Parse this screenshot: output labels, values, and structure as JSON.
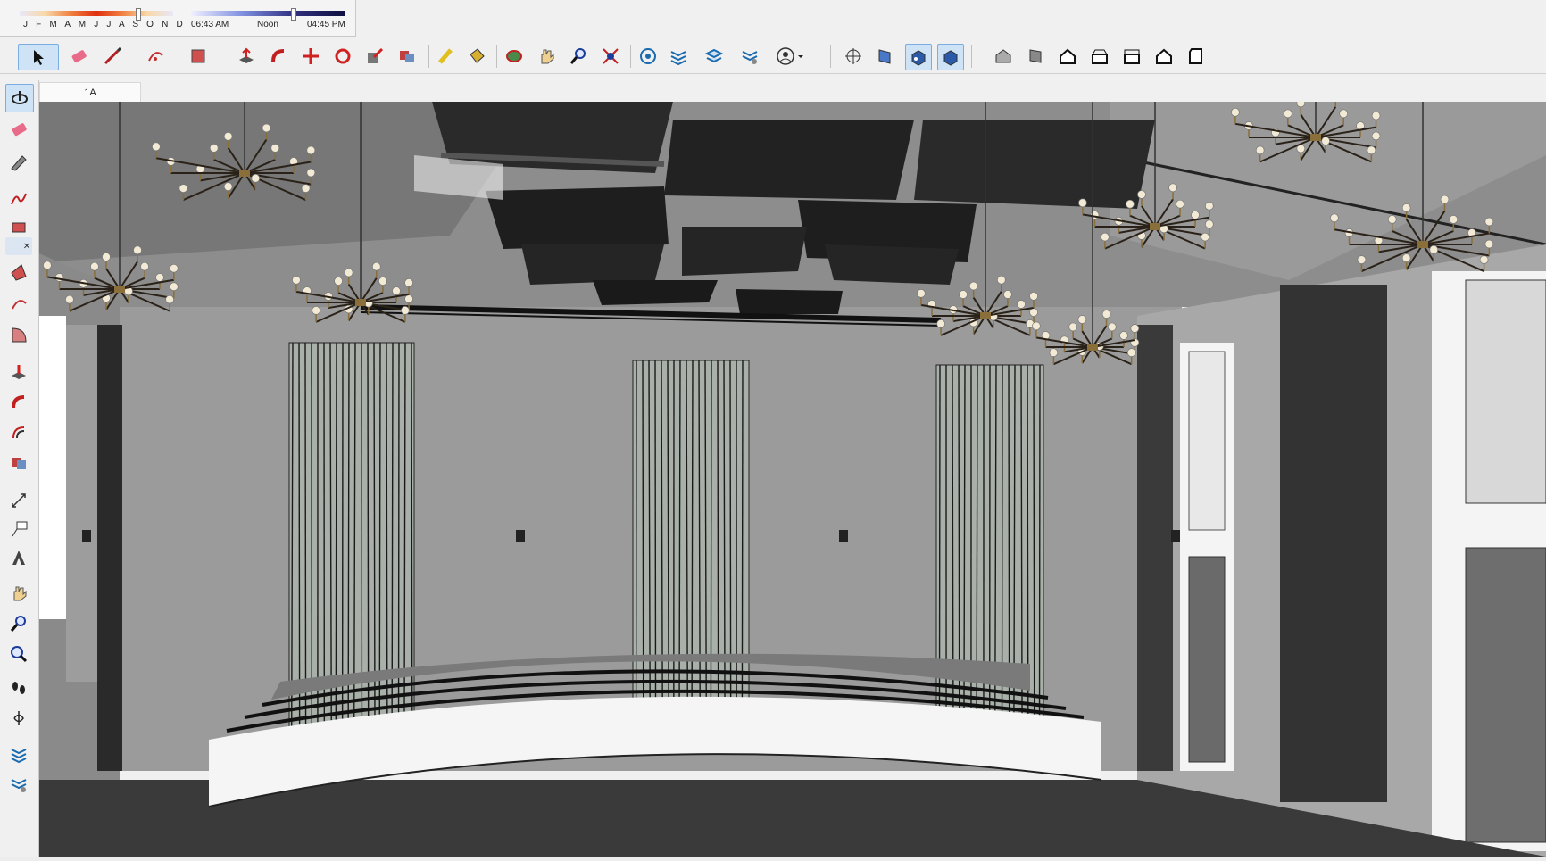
{
  "shadows": {
    "months": "J F M A M J J A S O N D",
    "time_start": "06:43 AM",
    "time_noon": "Noon",
    "time_end": "04:45 PM",
    "month_fraction": 0.77,
    "time_fraction": 0.66
  },
  "toolbar": {
    "active_tool": "select-tool",
    "icons": [
      "select-arrow-icon",
      "eraser-icon",
      "pencil-line-icon",
      "arc-icon",
      "rectangle-icon",
      "push-pull-icon",
      "follow-me-icon",
      "move-icon",
      "rotate-icon",
      "scale-icon",
      "offset-icon",
      "tape-measure-icon",
      "paint-bucket-icon",
      "orbit-icon",
      "pan-hand-icon",
      "zoom-icon",
      "zoom-extents-icon",
      "warehouse-icon",
      "extension-warehouse-icon",
      "layout-send-icon",
      "extension-manager-icon",
      "account-icon",
      "section-plane-icon",
      "display-section-planes-icon",
      "display-section-cuts-icon",
      "display-section-fill-icon",
      "iso-view-icon",
      "top-view-icon",
      "front-view-icon",
      "right-view-icon",
      "back-view-icon",
      "left-view-icon",
      "bottom-view-icon"
    ]
  },
  "left_toolbar": {
    "icons": [
      "orbit-icon",
      "eraser-icon",
      "paint-bucket-icon",
      "freehand-icon",
      "rectangle-icon",
      "close-icon",
      "rotated-rectangle-icon",
      "arc-icon",
      "pie-icon",
      "push-pull-icon",
      "follow-me-icon",
      "offset-icon",
      "intersect-icon",
      "dimension-icon",
      "text-label-icon",
      "3d-text-icon",
      "pan-hand-icon",
      "zoom-window-icon",
      "zoom-previous-icon",
      "walk-icon",
      "look-around-icon",
      "warehouse-icon",
      "extension-warehouse-icon"
    ]
  },
  "scene_tab": {
    "label": "1A"
  },
  "colors": {
    "ui_bg": "#f0f0f0",
    "active_highlight": "#cfe3f7",
    "floor": "#3a3a3a",
    "wall": "#9b9b9b",
    "ceiling": "#8a8a8a",
    "brass": "#8b6f3a",
    "bulb": "#f3ead6"
  }
}
